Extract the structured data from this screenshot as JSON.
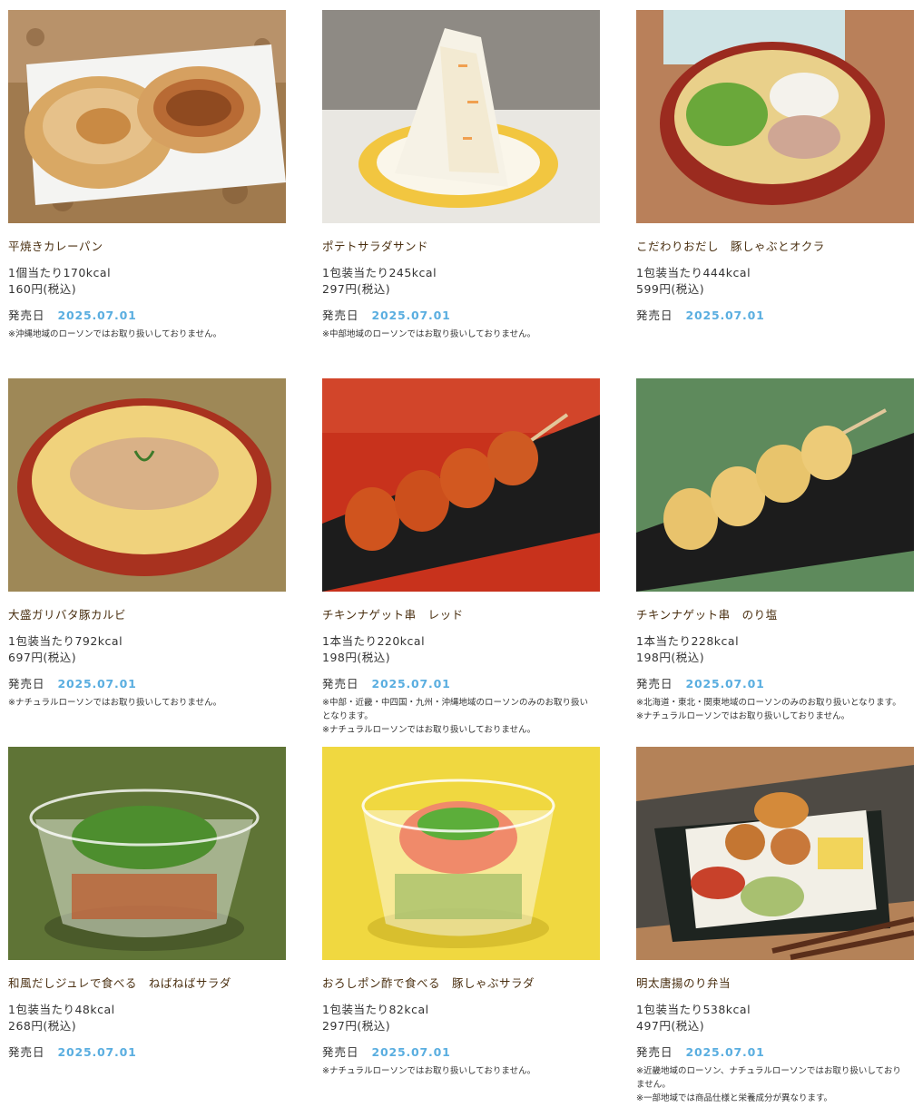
{
  "labels": {
    "release": "発売日"
  },
  "products": [
    {
      "name": "平焼きカレーパン",
      "kcal": "1個当たり170kcal",
      "price": "160円(税込)",
      "date": "2025.07.01",
      "notes": [
        "※沖縄地域のローソンではお取り扱いしておりません。"
      ],
      "image": "curry-bread-photo"
    },
    {
      "name": "ポテトサラダサンド",
      "kcal": "1包装当たり245kcal",
      "price": "297円(税込)",
      "date": "2025.07.01",
      "notes": [
        "※中部地域のローソンではお取り扱いしておりません。"
      ],
      "image": "potato-salad-sandwich-photo"
    },
    {
      "name": "こだわりおだし　豚しゃぶとオクラ",
      "kcal": "1包装当たり444kcal",
      "price": "599円(税込)",
      "date": "2025.07.01",
      "notes": [],
      "image": "pork-okra-noodle-photo"
    },
    {
      "name": "大盛ガリバタ豚カルビ",
      "kcal": "1包装当たり792kcal",
      "price": "697円(税込)",
      "date": "2025.07.01",
      "notes": [
        "※ナチュラルローソンではお取り扱いしておりません。"
      ],
      "image": "garlic-butter-pork-noodle-photo"
    },
    {
      "name": "チキンナゲット串　レッド",
      "kcal": "1本当たり220kcal",
      "price": "198円(税込)",
      "date": "2025.07.01",
      "notes": [
        "※中部・近畿・中四国・九州・沖縄地域のローソンのみのお取り扱いとなります。",
        "※ナチュラルローソンではお取り扱いしておりません。"
      ],
      "image": "red-nugget-skewer-photo"
    },
    {
      "name": "チキンナゲット串　のり塩",
      "kcal": "1本当たり228kcal",
      "price": "198円(税込)",
      "date": "2025.07.01",
      "notes": [
        "※北海道・東北・関東地域のローソンのみのお取り扱いとなります。",
        "※ナチュラルローソンではお取り扱いしておりません。"
      ],
      "image": "nori-salt-nugget-skewer-photo"
    },
    {
      "name": "和風だしジュレで食べる　ねばねばサラダ",
      "kcal": "1包装当たり48kcal",
      "price": "268円(税込)",
      "date": "2025.07.01",
      "notes": [],
      "image": "sticky-salad-photo"
    },
    {
      "name": "おろしポン酢で食べる　豚しゃぶサラダ",
      "kcal": "1包装当たり82kcal",
      "price": "297円(税込)",
      "date": "2025.07.01",
      "notes": [
        "※ナチュラルローソンではお取り扱いしておりません。"
      ],
      "image": "pork-shabu-salad-photo"
    },
    {
      "name": "明太唐揚のり弁当",
      "kcal": "1包装当たり538kcal",
      "price": "497円(税込)",
      "date": "2025.07.01",
      "notes": [
        "※近畿地域のローソン、ナチュラルローソンではお取り扱いしておりません。",
        "※一部地域では商品仕様と栄養成分が異なります。"
      ],
      "image": "mentai-karaage-bento-photo"
    }
  ]
}
